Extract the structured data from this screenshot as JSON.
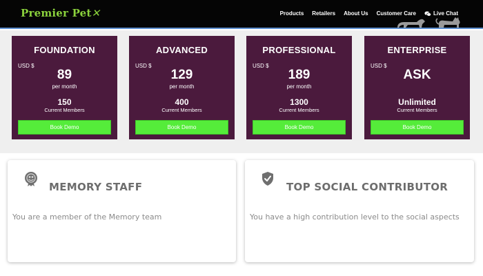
{
  "header": {
    "logo_text": "Premier Pet",
    "logo_tail": "✕",
    "nav": [
      "Products",
      "Retailers",
      "About Us",
      "Customer Care",
      "Live Chat"
    ]
  },
  "plans": [
    {
      "name": "FOUNDATION",
      "currency": "USD $",
      "price": "89",
      "period": "per month",
      "members": "150",
      "members_label": "Current Members",
      "button": "Book Demo"
    },
    {
      "name": "ADVANCED",
      "currency": "USD $",
      "price": "129",
      "period": "per month",
      "members": "400",
      "members_label": "Current Members",
      "button": "Book Demo"
    },
    {
      "name": "PROFESSIONAL",
      "currency": "USD $",
      "price": "189",
      "period": "per month",
      "members": "1300",
      "members_label": "Current Members",
      "button": "Book Demo"
    },
    {
      "name": "ENTERPRISE",
      "currency": "USD $",
      "price": "ASK",
      "period": "",
      "members": "Unlimited",
      "members_label": "Current Members",
      "button": "Book Demo"
    }
  ],
  "badges": [
    {
      "title": "MEMORY STAFF",
      "description": "You are a member of the Memory team",
      "icon": "memory-badge-icon"
    },
    {
      "title": "TOP SOCIAL CONTRIBUTOR",
      "description": "You have a high contribution level to the social aspects",
      "icon": "shield-check-icon"
    }
  ],
  "colors": {
    "header_bg": "#050505",
    "logo": "#8ad13c",
    "plan_bg": "#4b1a3d",
    "button_bg": "#55ec3a",
    "pricing_bg": "#efefef"
  }
}
